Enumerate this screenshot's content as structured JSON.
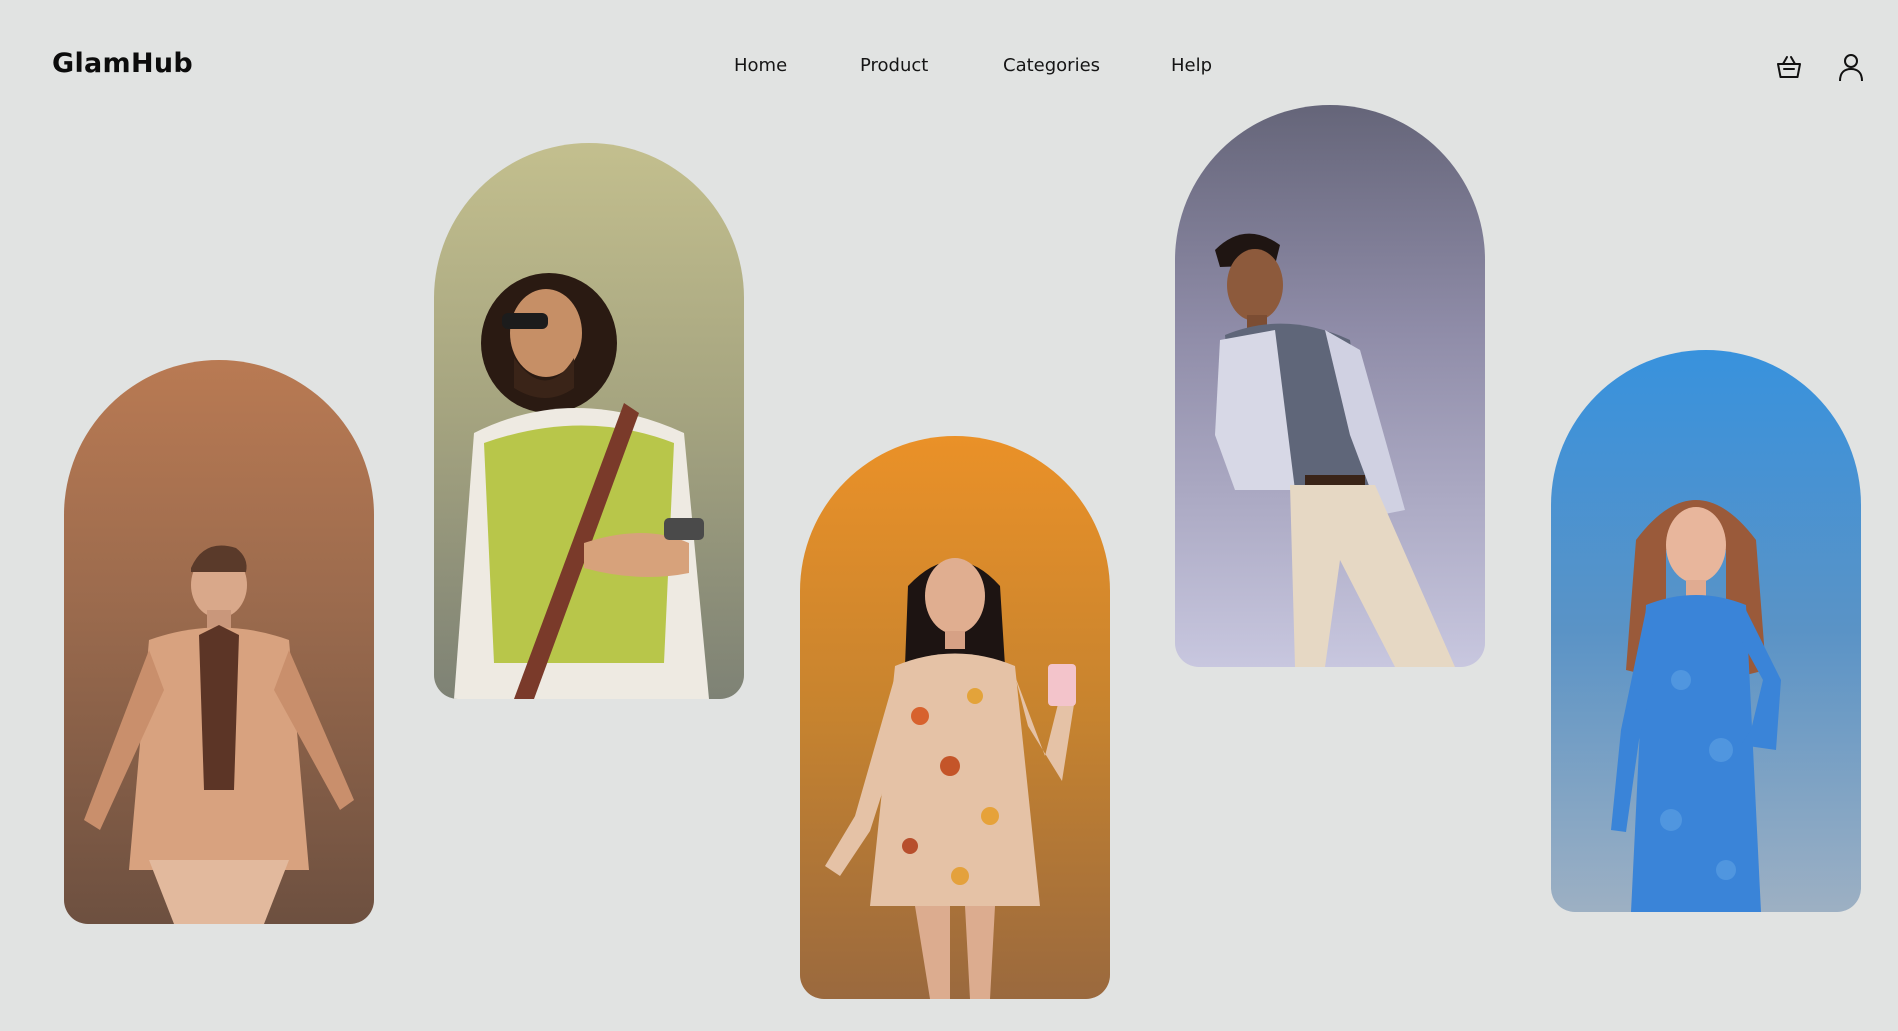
{
  "app": {
    "logo": "GlamHub"
  },
  "nav": {
    "items": [
      "Home",
      "Product",
      "Categories",
      "Help"
    ]
  },
  "header_icons": {
    "cart": "basket-icon",
    "account": "user-icon"
  },
  "gallery": {
    "items": [
      {
        "subject": "man-beige-suit",
        "accent": "#b97a53"
      },
      {
        "subject": "man-knit-vest-sunglasses",
        "accent": "#c3bf8e"
      },
      {
        "subject": "woman-floral-dress-coffee",
        "accent": "#ea9128"
      },
      {
        "subject": "man-grey-blazer",
        "accent": "#656579"
      },
      {
        "subject": "woman-blue-lace-dress",
        "accent": "#3892dd"
      }
    ]
  }
}
